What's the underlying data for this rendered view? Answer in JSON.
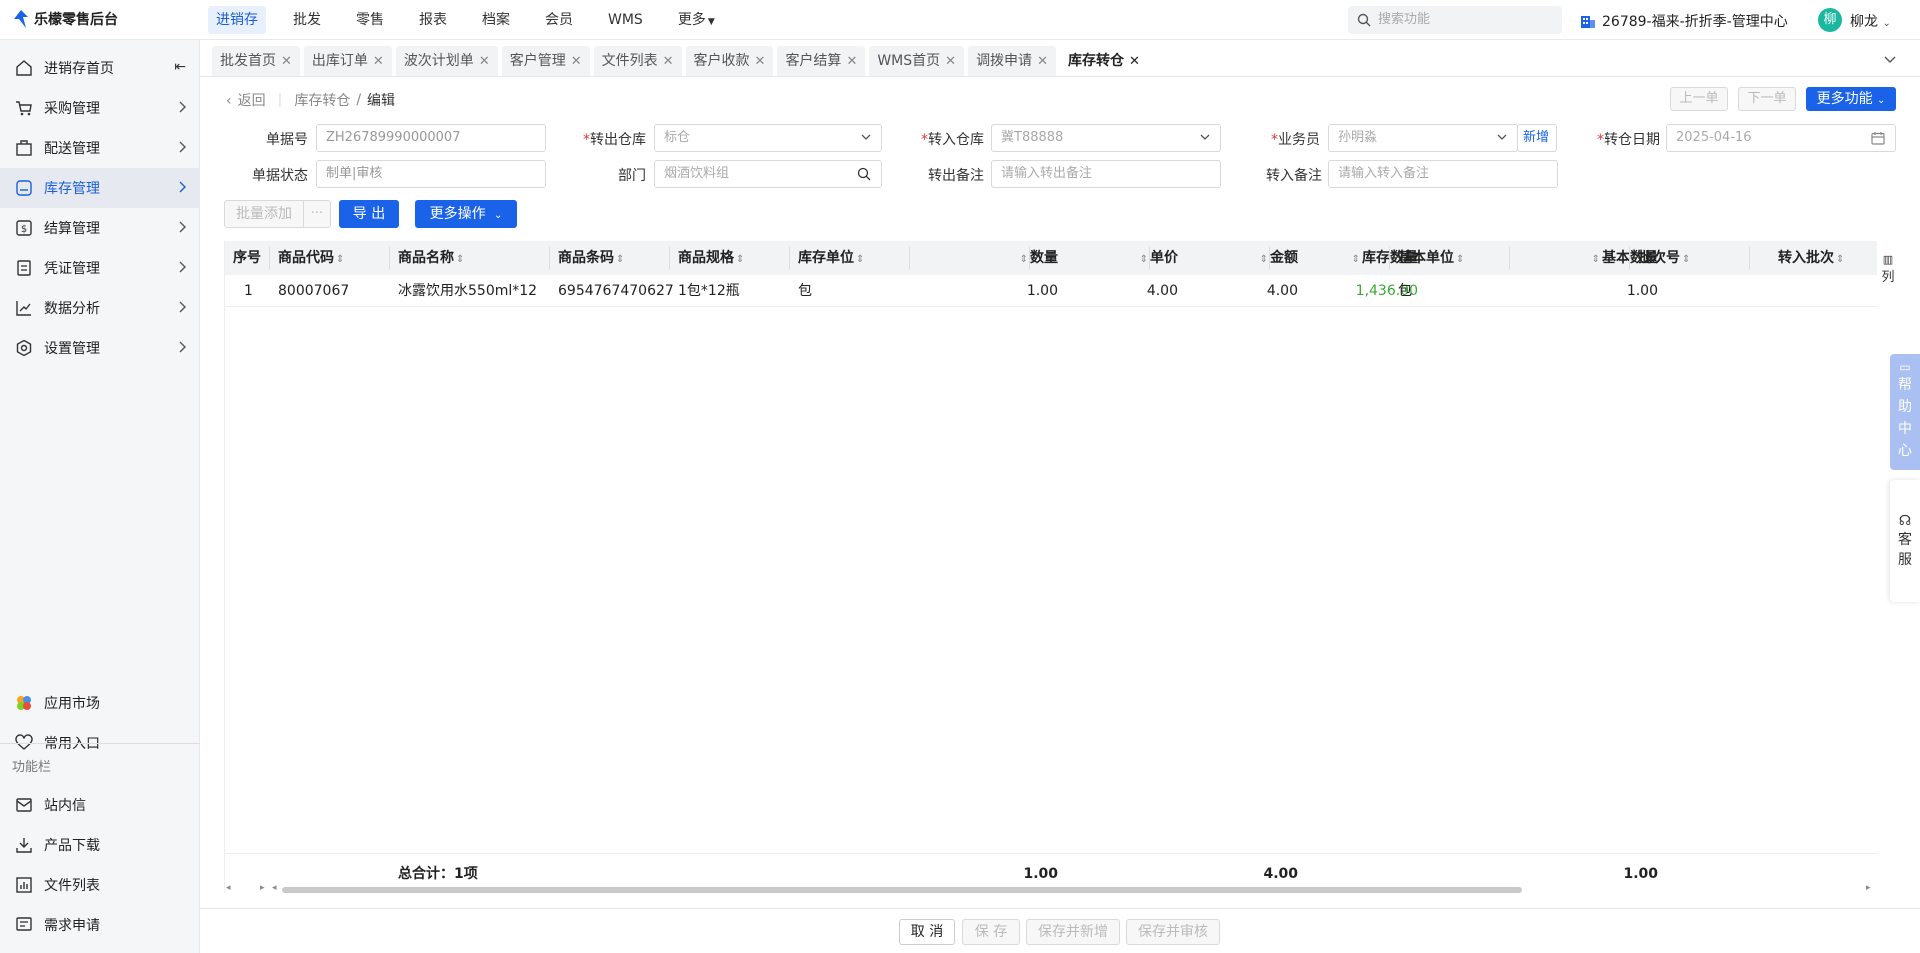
{
  "app": {
    "title": "乐檬零售后台"
  },
  "topnav": [
    {
      "label": "进销存",
      "active": true
    },
    {
      "label": "批发"
    },
    {
      "label": "零售"
    },
    {
      "label": "报表"
    },
    {
      "label": "档案"
    },
    {
      "label": "会员"
    },
    {
      "label": "WMS"
    },
    {
      "label": "更多"
    }
  ],
  "search": {
    "placeholder": "搜索功能"
  },
  "org": {
    "label": "26789-福来-折折季-管理中心"
  },
  "user": {
    "avatar": "柳",
    "name": "柳龙"
  },
  "sidebar": {
    "items": [
      {
        "label": "进销存首页",
        "icon": "home-icon"
      },
      {
        "label": "采购管理",
        "icon": "cart-icon"
      },
      {
        "label": "配送管理",
        "icon": "delivery-icon"
      },
      {
        "label": "库存管理",
        "icon": "inventory-icon",
        "active": true
      },
      {
        "label": "结算管理",
        "icon": "dollar-icon"
      },
      {
        "label": "凭证管理",
        "icon": "voucher-icon"
      },
      {
        "label": "数据分析",
        "icon": "chart-icon"
      },
      {
        "label": "设置管理",
        "icon": "settings-icon"
      }
    ],
    "bottom": [
      {
        "label": "应用市场",
        "icon": "app-market-icon"
      },
      {
        "label": "常用入口",
        "icon": "heart-icon"
      }
    ],
    "group_label": "功能栏",
    "functions": [
      {
        "label": "站内信",
        "icon": "mail-icon"
      },
      {
        "label": "产品下载",
        "icon": "download-icon"
      },
      {
        "label": "文件列表",
        "icon": "file-list-icon"
      },
      {
        "label": "需求申请",
        "icon": "request-icon"
      }
    ]
  },
  "tabs": [
    {
      "label": "批发首页"
    },
    {
      "label": "出库订单"
    },
    {
      "label": "波次计划单"
    },
    {
      "label": "客户管理"
    },
    {
      "label": "文件列表"
    },
    {
      "label": "客户收款"
    },
    {
      "label": "客户结算"
    },
    {
      "label": "WMS首页"
    },
    {
      "label": "调拨申请"
    },
    {
      "label": "库存转仓",
      "active": true
    }
  ],
  "breadcrumb": {
    "back": "返回",
    "parent": "库存转仓",
    "sep": "/",
    "current": "编辑"
  },
  "header_buttons": {
    "prev": "上一单",
    "next": "下一单",
    "more": "更多功能"
  },
  "form": {
    "doc_no": {
      "label": "单据号",
      "value": "ZH26789990000007"
    },
    "out_wh": {
      "label": "转出仓库",
      "value": "标仓"
    },
    "in_wh": {
      "label": "转入仓库",
      "value": "冀T88888"
    },
    "salesman": {
      "label": "业务员",
      "value": "孙明淼",
      "add": "新增"
    },
    "date": {
      "label": "转仓日期",
      "value": "2025-04-16"
    },
    "status": {
      "label": "单据状态",
      "value": "制单|审核"
    },
    "dept": {
      "label": "部门",
      "value": "烟酒饮料组"
    },
    "out_note": {
      "label": "转出备注",
      "placeholder": "请输入转出备注"
    },
    "in_note": {
      "label": "转入备注",
      "placeholder": "请输入转入备注"
    }
  },
  "toolbar": {
    "batch_add": "批量添加",
    "dots": "···",
    "export": "导 出",
    "more_ops": "更多操作"
  },
  "table": {
    "columns": [
      "序号",
      "商品代码",
      "商品名称",
      "商品条码",
      "商品规格",
      "库存单位",
      "数量",
      "单价",
      "金额",
      "库存数量",
      "基本单位",
      "基本数量",
      "批次号",
      "转入批次"
    ],
    "col_setting": "列",
    "rows": [
      {
        "idx": "1",
        "code": "80007067",
        "name": "冰露饮用水550ml*12",
        "barcode": "6954767470627",
        "spec": "1包*12瓶",
        "unit": "包",
        "qty": "1.00",
        "price": "4.00",
        "amount": "4.00",
        "stock_qty": "1,436.00",
        "base_unit": "包",
        "base_qty": "1.00",
        "batch": "",
        "in_batch": ""
      }
    ],
    "footer": {
      "total_label": "总合计：1项",
      "qty": "1.00",
      "amount": "4.00",
      "base_qty": "1.00"
    }
  },
  "footer_buttons": {
    "cancel": "取 消",
    "save": "保 存",
    "save_new": "保存并新增",
    "save_audit": "保存并审核"
  },
  "float": {
    "help": [
      "帮",
      "助",
      "中",
      "心"
    ],
    "service": [
      "客",
      "服"
    ]
  },
  "colors": {
    "primary": "#1a62e8",
    "green": "#3aaa35",
    "required": "#e53935"
  }
}
